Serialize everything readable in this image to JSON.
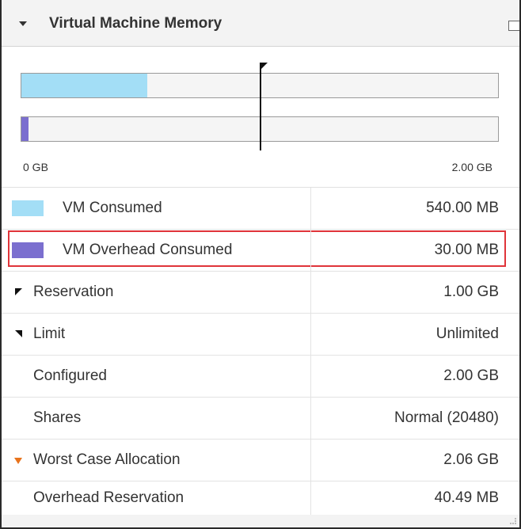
{
  "panel": {
    "title": "Virtual Machine Memory"
  },
  "memory_bar": {
    "axis_min_label": "0 GB",
    "axis_max_label": "2.00 GB",
    "vm_consumed_fraction": 0.2637,
    "vm_overhead_fraction": 0.0146,
    "reservation_fraction": 0.5,
    "consumed_color": "#a3def6",
    "overhead_color": "#7b6fcf"
  },
  "rows": [
    {
      "label": "VM Consumed",
      "value": "540.00 MB",
      "marker": "swatch",
      "color": "#a3def6"
    },
    {
      "label": "VM Overhead Consumed",
      "value": "30.00 MB",
      "marker": "swatch",
      "color": "#7b6fcf",
      "highlighted": true
    },
    {
      "label": "Reservation",
      "value": "1.00 GB",
      "marker": "reservation-flag-icon"
    },
    {
      "label": "Limit",
      "value": "Unlimited",
      "marker": "limit-flag-icon"
    },
    {
      "label": "Configured",
      "value": "2.00 GB",
      "marker": "none"
    },
    {
      "label": "Shares",
      "value": "Normal (20480)",
      "marker": "none"
    },
    {
      "label": "Worst Case Allocation",
      "value": "2.06 GB",
      "marker": "orange-triangle-icon",
      "color": "#e8731c"
    },
    {
      "label": "Overhead Reservation",
      "value": "40.49 MB",
      "marker": "none"
    }
  ]
}
